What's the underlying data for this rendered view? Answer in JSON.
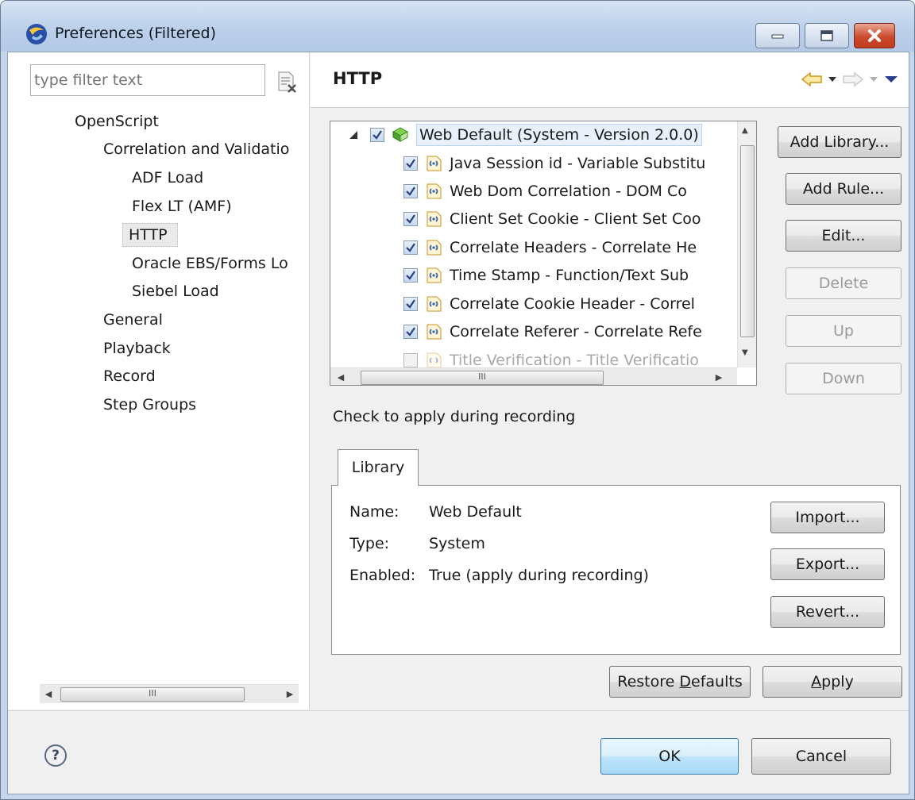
{
  "window": {
    "title": "Preferences (Filtered)"
  },
  "filter": {
    "placeholder": "type filter text"
  },
  "tree": [
    {
      "label": "OpenScript",
      "level": 0
    },
    {
      "label": "Correlation and Validatio",
      "level": 1
    },
    {
      "label": "ADF Load",
      "level": 2
    },
    {
      "label": "Flex LT (AMF)",
      "level": 2
    },
    {
      "label": "HTTP",
      "level": 2,
      "selected": true
    },
    {
      "label": "Oracle EBS/Forms Lo",
      "level": 2
    },
    {
      "label": "Siebel Load",
      "level": 2
    },
    {
      "label": "General",
      "level": 1
    },
    {
      "label": "Playback",
      "level": 1
    },
    {
      "label": "Record",
      "level": 1
    },
    {
      "label": "Step Groups",
      "level": 1
    }
  ],
  "page": {
    "title": "HTTP",
    "hint": "Check to apply during recording"
  },
  "rules": {
    "library": {
      "label": "Web Default (System - Version 2.0.0)",
      "checked": true
    },
    "items": [
      {
        "label": "Java Session id - Variable Substitu",
        "checked": true
      },
      {
        "label": "Web Dom Correlation - DOM Co",
        "checked": true
      },
      {
        "label": "Client Set Cookie - Client Set Coo",
        "checked": true
      },
      {
        "label": "Correlate Headers - Correlate He",
        "checked": true
      },
      {
        "label": "Time Stamp - Function/Text Sub",
        "checked": true
      },
      {
        "label": "Correlate Cookie Header - Correl",
        "checked": true
      },
      {
        "label": "Correlate Referer - Correlate Refe",
        "checked": true
      },
      {
        "label": "Title Verification - Title Verificatio",
        "checked": false
      }
    ]
  },
  "side_buttons": {
    "add_library": "Add Library...",
    "add_rule": "Add Rule...",
    "edit": "Edit...",
    "delete": "Delete",
    "up": "Up",
    "down": "Down"
  },
  "library_tab": {
    "tab": "Library",
    "name_label": "Name:",
    "name_value": "Web Default",
    "type_label": "Type:",
    "type_value": "System",
    "enabled_label": "Enabled:",
    "enabled_value": "True (apply during recording)",
    "import": "Import...",
    "export": "Export...",
    "revert": "Revert..."
  },
  "page_buttons": {
    "restore_prefix": "Restore ",
    "restore_mnemonic": "D",
    "restore_suffix": "efaults",
    "apply_mnemonic": "A",
    "apply_suffix": "pply"
  },
  "dialog_buttons": {
    "ok": "OK",
    "cancel": "Cancel"
  },
  "icons": {
    "help": "?"
  }
}
